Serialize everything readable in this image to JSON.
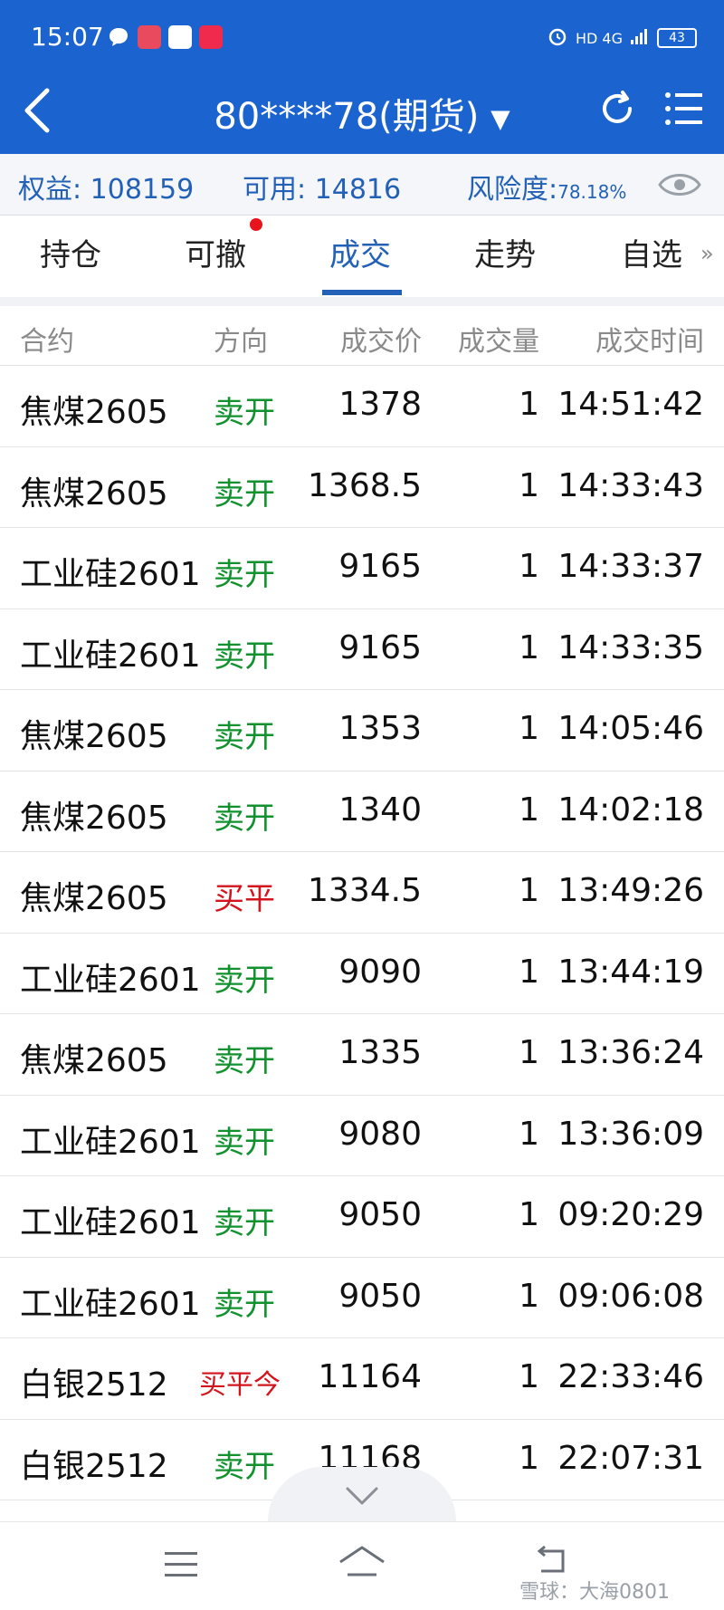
{
  "status": {
    "time": "15:07",
    "network": "HD 4G",
    "battery": "43"
  },
  "appbar": {
    "title": "80****78(期货)"
  },
  "summary": {
    "equity_label": "权益:",
    "equity_value": "108159",
    "available_label": "可用:",
    "available_value": "14816",
    "risk_label": "风险度:",
    "risk_value": "78.18%"
  },
  "tabs": [
    "持仓",
    "可撤",
    "成交",
    "走势",
    "自选"
  ],
  "active_tab_index": 2,
  "table": {
    "headers": [
      "合约",
      "方向",
      "成交价",
      "成交量",
      "成交时间"
    ],
    "rows": [
      [
        "焦煤2605",
        "卖开",
        "1378",
        "1",
        "14:51:42"
      ],
      [
        "焦煤2605",
        "卖开",
        "1368.5",
        "1",
        "14:33:43"
      ],
      [
        "工业硅2601",
        "卖开",
        "9165",
        "1",
        "14:33:37"
      ],
      [
        "工业硅2601",
        "卖开",
        "9165",
        "1",
        "14:33:35"
      ],
      [
        "焦煤2605",
        "卖开",
        "1353",
        "1",
        "14:05:46"
      ],
      [
        "焦煤2605",
        "卖开",
        "1340",
        "1",
        "14:02:18"
      ],
      [
        "焦煤2605",
        "买平",
        "1334.5",
        "1",
        "13:49:26"
      ],
      [
        "工业硅2601",
        "卖开",
        "9090",
        "1",
        "13:44:19"
      ],
      [
        "焦煤2605",
        "卖开",
        "1335",
        "1",
        "13:36:24"
      ],
      [
        "工业硅2601",
        "卖开",
        "9080",
        "1",
        "13:36:09"
      ],
      [
        "工业硅2601",
        "卖开",
        "9050",
        "1",
        "09:20:29"
      ],
      [
        "工业硅2601",
        "卖开",
        "9050",
        "1",
        "09:06:08"
      ],
      [
        "白银2512",
        "买平今",
        "11164",
        "1",
        "22:33:46"
      ],
      [
        "白银2512",
        "卖开",
        "11168",
        "1",
        "22:07:31"
      ]
    ]
  },
  "colors": {
    "primary": "#1b63cf",
    "sell": "#11922e",
    "buy": "#d4141c"
  },
  "watermark": "雪球：大海0801"
}
